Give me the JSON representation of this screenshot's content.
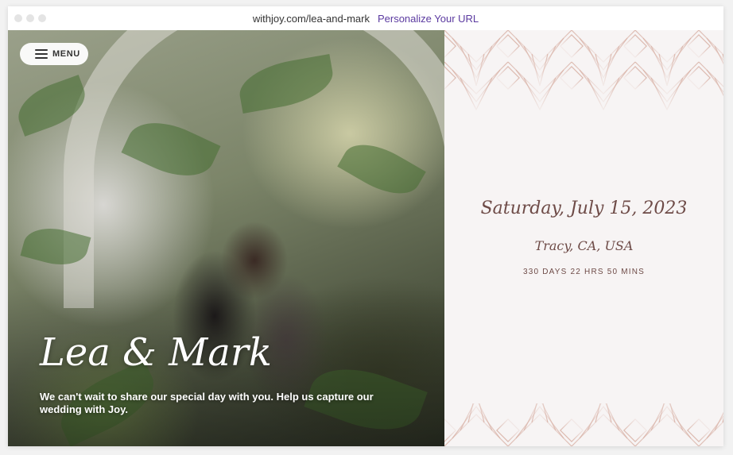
{
  "browser": {
    "url": "withjoy.com/lea-and-mark",
    "link_label": "Personalize Your URL",
    "link_color": "#5b3aa0"
  },
  "hero": {
    "menu_label": "MENU",
    "names": "Lea & Mark",
    "tagline": "We can't wait to share our special day with you. Help us capture our wedding with Joy."
  },
  "event": {
    "date": "Saturday, July 15, 2023",
    "location": "Tracy, CA, USA",
    "countdown": "330 DAYS 22 HRS 50 MINS"
  },
  "colors": {
    "accent_text": "#6e4b47",
    "pattern_line": "#d9b3a8",
    "panel_bg": "#f7f4f4"
  }
}
